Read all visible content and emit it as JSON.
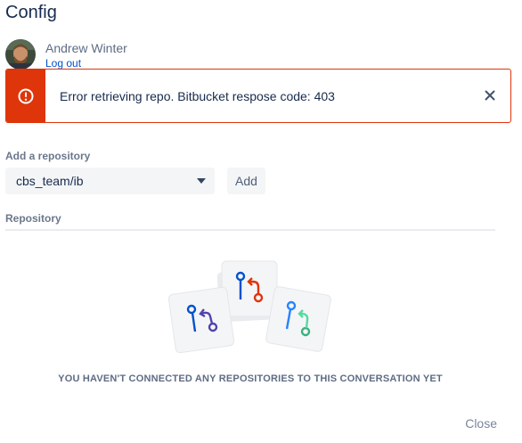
{
  "header": {
    "title": "Config"
  },
  "user": {
    "name": "Andrew Winter",
    "logout_label": "Log out"
  },
  "error_flag": {
    "message": "Error retrieving repo. Bitbucket respose code: 403",
    "icon": "error-icon",
    "color": "#de350b"
  },
  "add_repository": {
    "label": "Add a repository",
    "selected_value": "cbs_team/ib",
    "add_label": "Add"
  },
  "repository_section": {
    "label": "Repository",
    "empty_message": "YOU HAVEN'T CONNECTED ANY REPOSITORIES TO THIS CONVERSATION YET"
  },
  "footer": {
    "close_label": "Close"
  },
  "colors": {
    "accent": "#0052cc",
    "error": "#de350b",
    "text": "#172b4d",
    "muted": "#6b778c"
  }
}
